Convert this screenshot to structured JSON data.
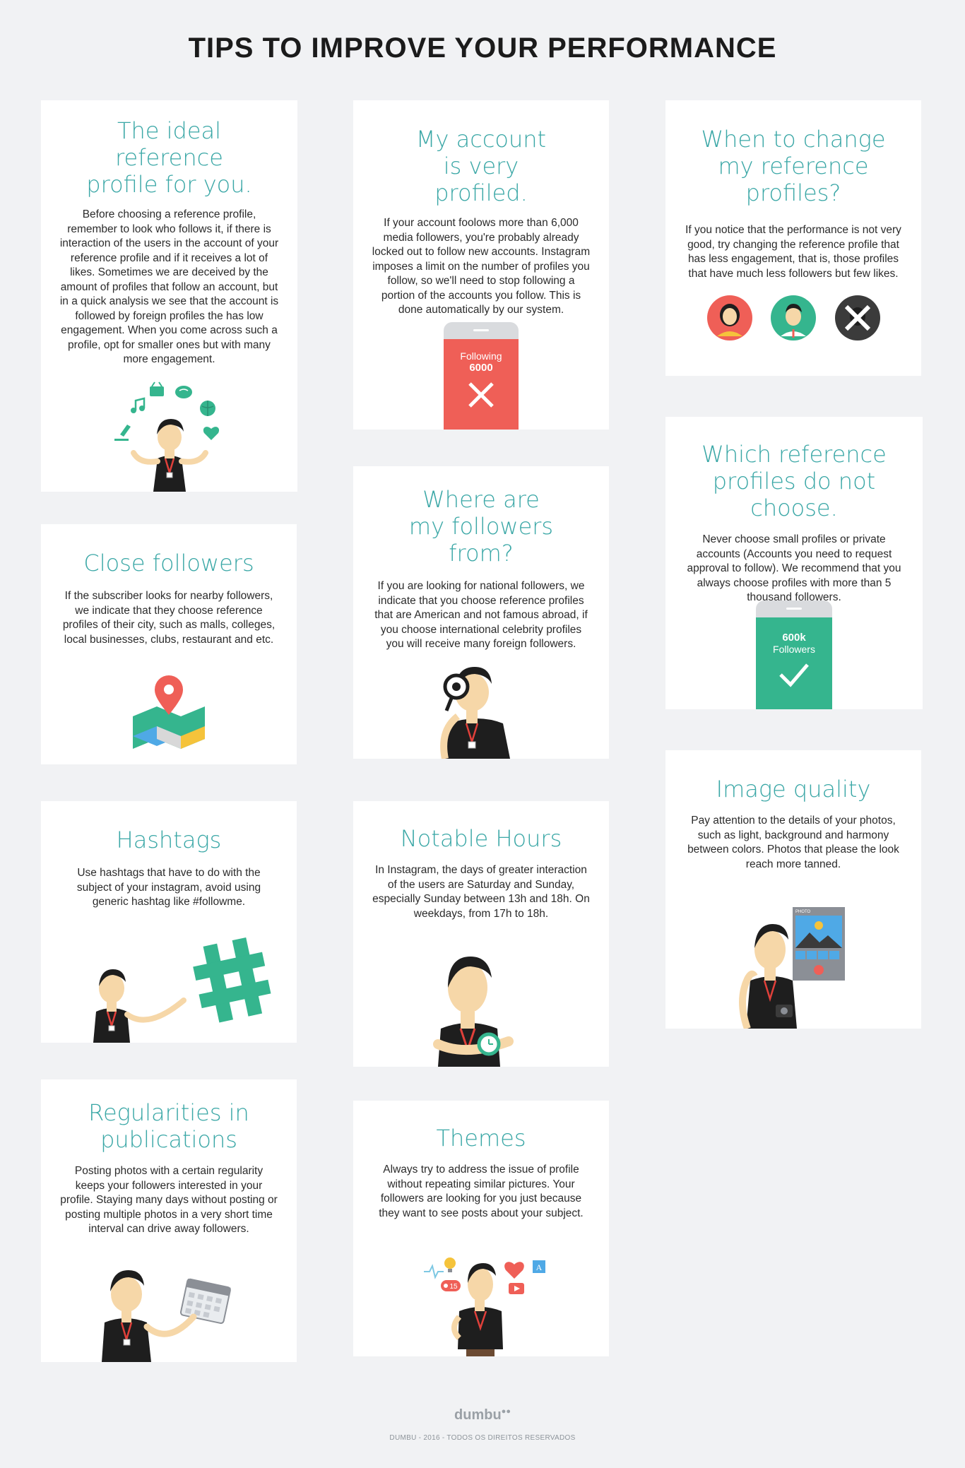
{
  "page": {
    "title": "TIPS TO IMPROVE YOUR PERFORMANCE"
  },
  "cards": {
    "ideal": {
      "title": "The ideal reference profile for you.",
      "body": "Before choosing a reference profile, remember to look who follows it, if there is interaction of the users in the account of your reference profile and if it receives a lot of likes. Sometimes we are deceived by the amount of profiles that follow an account, but in a quick analysis we see that the account is followed by foreign profiles the has low engagement.  When you come across such a profile, opt for smaller ones but with many more engagement."
    },
    "account": {
      "title": "My account is very profiled.",
      "body": "If your account foolows more than 6,000 media followers, you're probably already locked out to follow new accounts. Instagram imposes a limit on the number of profiles you follow, so we'll need to stop following a portion of the accounts you follow. This is done automatically by our system.",
      "phone_label": "Following",
      "phone_value": "6000"
    },
    "change": {
      "title": "When to change my reference profiles?",
      "body": "If you notice that the performance is not very good, try changing the reference profile that has less engagement, that is, those profiles that have much less followers but few likes."
    },
    "close": {
      "title": "Close followers",
      "body": "If the subscriber looks for nearby followers, we indicate that they choose reference profiles of their city, such as malls, colleges, local businesses, clubs, restaurant and etc."
    },
    "where": {
      "title": "Where are my followers from?",
      "body": "If you are looking for national followers, we indicate that you choose reference profiles that are American and not famous abroad, if you choose international celebrity profiles you will receive many foreign followers."
    },
    "which": {
      "title": "Which reference profiles do not choose.",
      "body": "Never choose small profiles or private accounts (Accounts you need to request approval to follow). We recommend that you always choose profiles with more than 5 thousand followers.",
      "phone_value": "600k",
      "phone_label": "Followers"
    },
    "hashtags": {
      "title": "Hashtags",
      "body": "Use hashtags that have to do with the subject of your instagram, avoid using generic hashtag like #followme."
    },
    "hours": {
      "title": "Notable Hours",
      "body": "In Instagram, the days of greater interaction of the users are Saturday and Sunday, especially Sunday between 13h and 18h. On weekdays, from 17h to 18h."
    },
    "quality": {
      "title": "Image quality",
      "body": "Pay attention to the details of your photos, such as light, background and harmony between colors. Photos that please the look reach more tanned.",
      "photo_label": "PHOTO"
    },
    "regular": {
      "title": "Regularities in publications",
      "body": "Posting photos with a certain regularity keeps your followers interested in your profile. Staying many days without posting or posting multiple photos in a very short time interval can drive away followers."
    },
    "themes": {
      "title": "Themes",
      "body": "Always try to address the issue of profile without repeating similar pictures. Your followers are looking for you just because they want to see posts about your subject.",
      "badge": "15"
    }
  },
  "footer": {
    "logo": "dumbu",
    "copyright": "DUMBU - 2016 - TODOS OS DIREITOS RESERVADOS"
  },
  "colors": {
    "accent": "#3aa7a6",
    "danger": "#ef5f57",
    "success": "#35b58e",
    "background": "#f1f2f4"
  }
}
